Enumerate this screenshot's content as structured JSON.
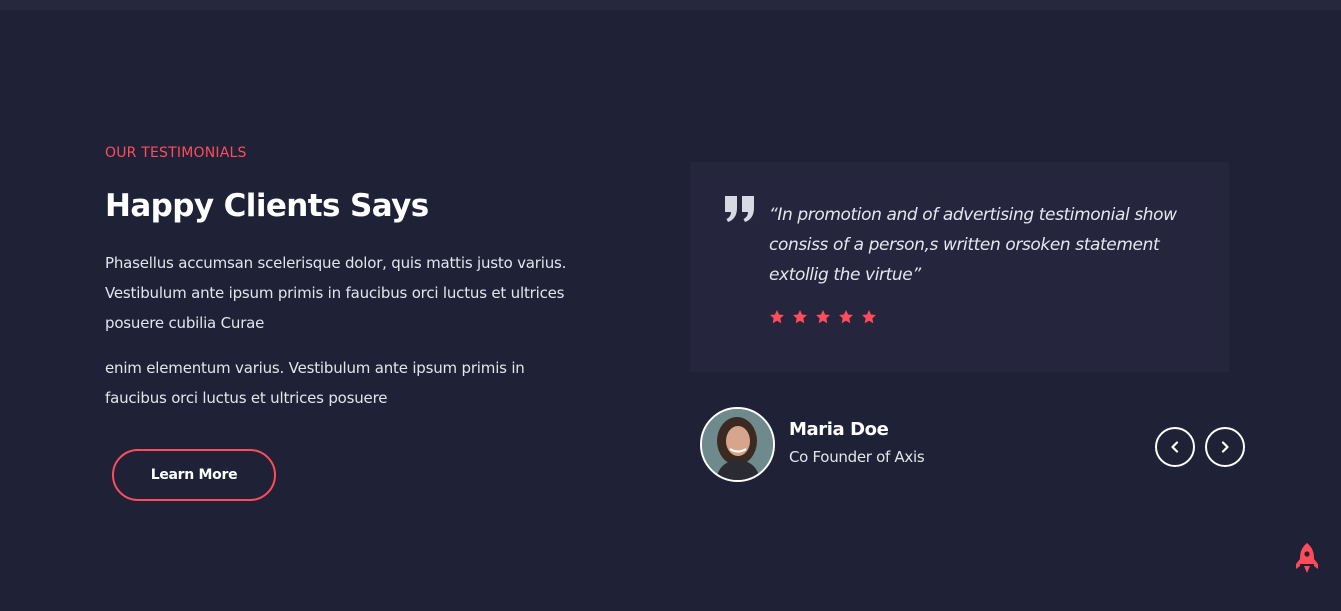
{
  "section": {
    "eyebrow": "OUR TESTIMONIALS",
    "title": "Happy Clients Says",
    "paragraphs": [
      "Phasellus accumsan scelerisque dolor, quis mattis justo varius. Vestibulum ante ipsum primis in faucibus orci luctus et ultrices posuere cubilia Curae",
      "enim elementum varius. Vestibulum ante ipsum primis in faucibus orci luctus et ultrices posuere"
    ],
    "cta_label": "Learn More"
  },
  "testimonial": {
    "quote": "“In promotion and of advertising testimonial show consiss of a person,s written orsoken statement extollig the virtue”",
    "rating": 5,
    "rating_max": 5,
    "client_name": "Maria Doe",
    "client_role": "Co Founder of Axis"
  },
  "icons": {
    "quote": "quote-icon",
    "star": "star-icon",
    "prev": "chevron-left-icon",
    "next": "chevron-right-icon",
    "scroll_top": "rocket-icon"
  },
  "colors": {
    "background": "#1f2237",
    "card": "#25263d",
    "accent": "#ff4c5b",
    "text": "#e6e6ee",
    "white": "#ffffff"
  }
}
